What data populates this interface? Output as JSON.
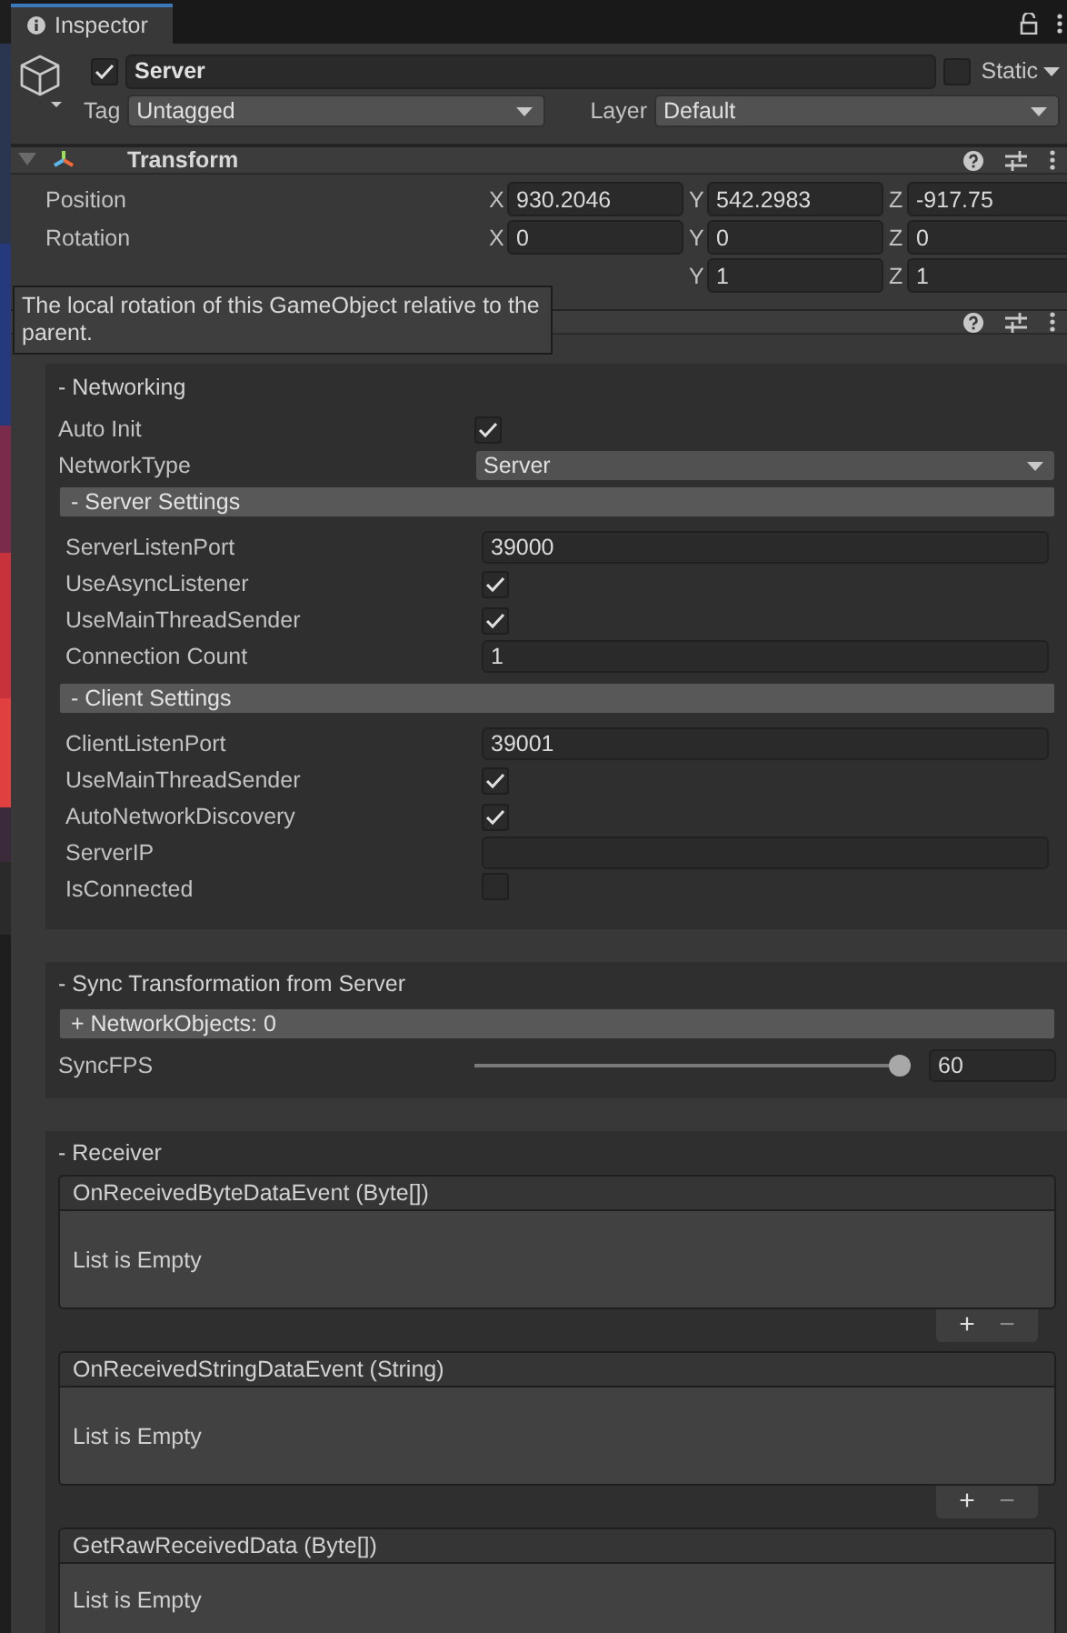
{
  "tab": {
    "label": "Inspector"
  },
  "object": {
    "active": true,
    "name": "Server",
    "static": false,
    "static_label": "Static",
    "tag_label": "Tag",
    "tag": "Untagged",
    "layer_label": "Layer",
    "layer": "Default"
  },
  "transform": {
    "title": "Transform",
    "expanded": true,
    "rows": [
      {
        "label": "Position",
        "fields": [
          {
            "axis": "X",
            "value": "930.2046"
          },
          {
            "axis": "Y",
            "value": "542.2983"
          },
          {
            "axis": "Z",
            "value": "-917.75"
          }
        ]
      },
      {
        "label": "Rotation",
        "fields": [
          {
            "axis": "X",
            "value": "0"
          },
          {
            "axis": "Y",
            "value": "0"
          },
          {
            "axis": "Z",
            "value": "0"
          }
        ]
      },
      {
        "fields": [
          {
            "axis": "Y",
            "value": "1"
          },
          {
            "axis": "Z",
            "value": "1"
          }
        ]
      }
    ]
  },
  "tooltip": {
    "text": "The local rotation of this GameObject relative to the parent."
  },
  "sections": [
    {
      "title": "- Networking",
      "items": [
        {
          "kind": "check",
          "label": "Auto Init",
          "checked": true
        },
        {
          "kind": "dropdown",
          "label": "NetworkType",
          "value": "Server"
        },
        {
          "kind": "group",
          "title": "- Server Settings",
          "items": [
            {
              "kind": "text",
              "label": "ServerListenPort",
              "value": "39000"
            },
            {
              "kind": "check",
              "label": "UseAsyncListener",
              "checked": true
            },
            {
              "kind": "check",
              "label": "UseMainThreadSender",
              "checked": true
            },
            {
              "kind": "text",
              "label": "Connection Count",
              "value": "1"
            }
          ]
        },
        {
          "kind": "group",
          "title": "- Client Settings",
          "items": [
            {
              "kind": "text",
              "label": "ClientListenPort",
              "value": "39001"
            },
            {
              "kind": "check",
              "label": "UseMainThreadSender",
              "checked": true
            },
            {
              "kind": "check",
              "label": "AutoNetworkDiscovery",
              "checked": true
            },
            {
              "kind": "text",
              "label": "ServerIP"
            },
            {
              "kind": "check",
              "label": "IsConnected",
              "checked": false
            }
          ]
        }
      ]
    },
    {
      "title": "- Sync Transformation from Server",
      "items": [
        {
          "kind": "group",
          "title": "+ NetworkObjects: 0"
        },
        {
          "kind": "slider",
          "label": "SyncFPS",
          "level": 1.0,
          "value": "60"
        }
      ]
    },
    {
      "title": "- Receiver",
      "items": [
        {
          "kind": "event",
          "title": "OnReceivedByteDataEvent (Byte[])",
          "empty_text": "List is Empty",
          "buttons": [
            "+",
            "−"
          ]
        },
        {
          "kind": "event",
          "title": "OnReceivedStringDataEvent (String)",
          "empty_text": "List is Empty",
          "buttons": [
            "+",
            "−"
          ]
        },
        {
          "kind": "event",
          "title": "GetRawReceivedData (Byte[])",
          "empty_text": "List is Empty"
        }
      ]
    }
  ]
}
